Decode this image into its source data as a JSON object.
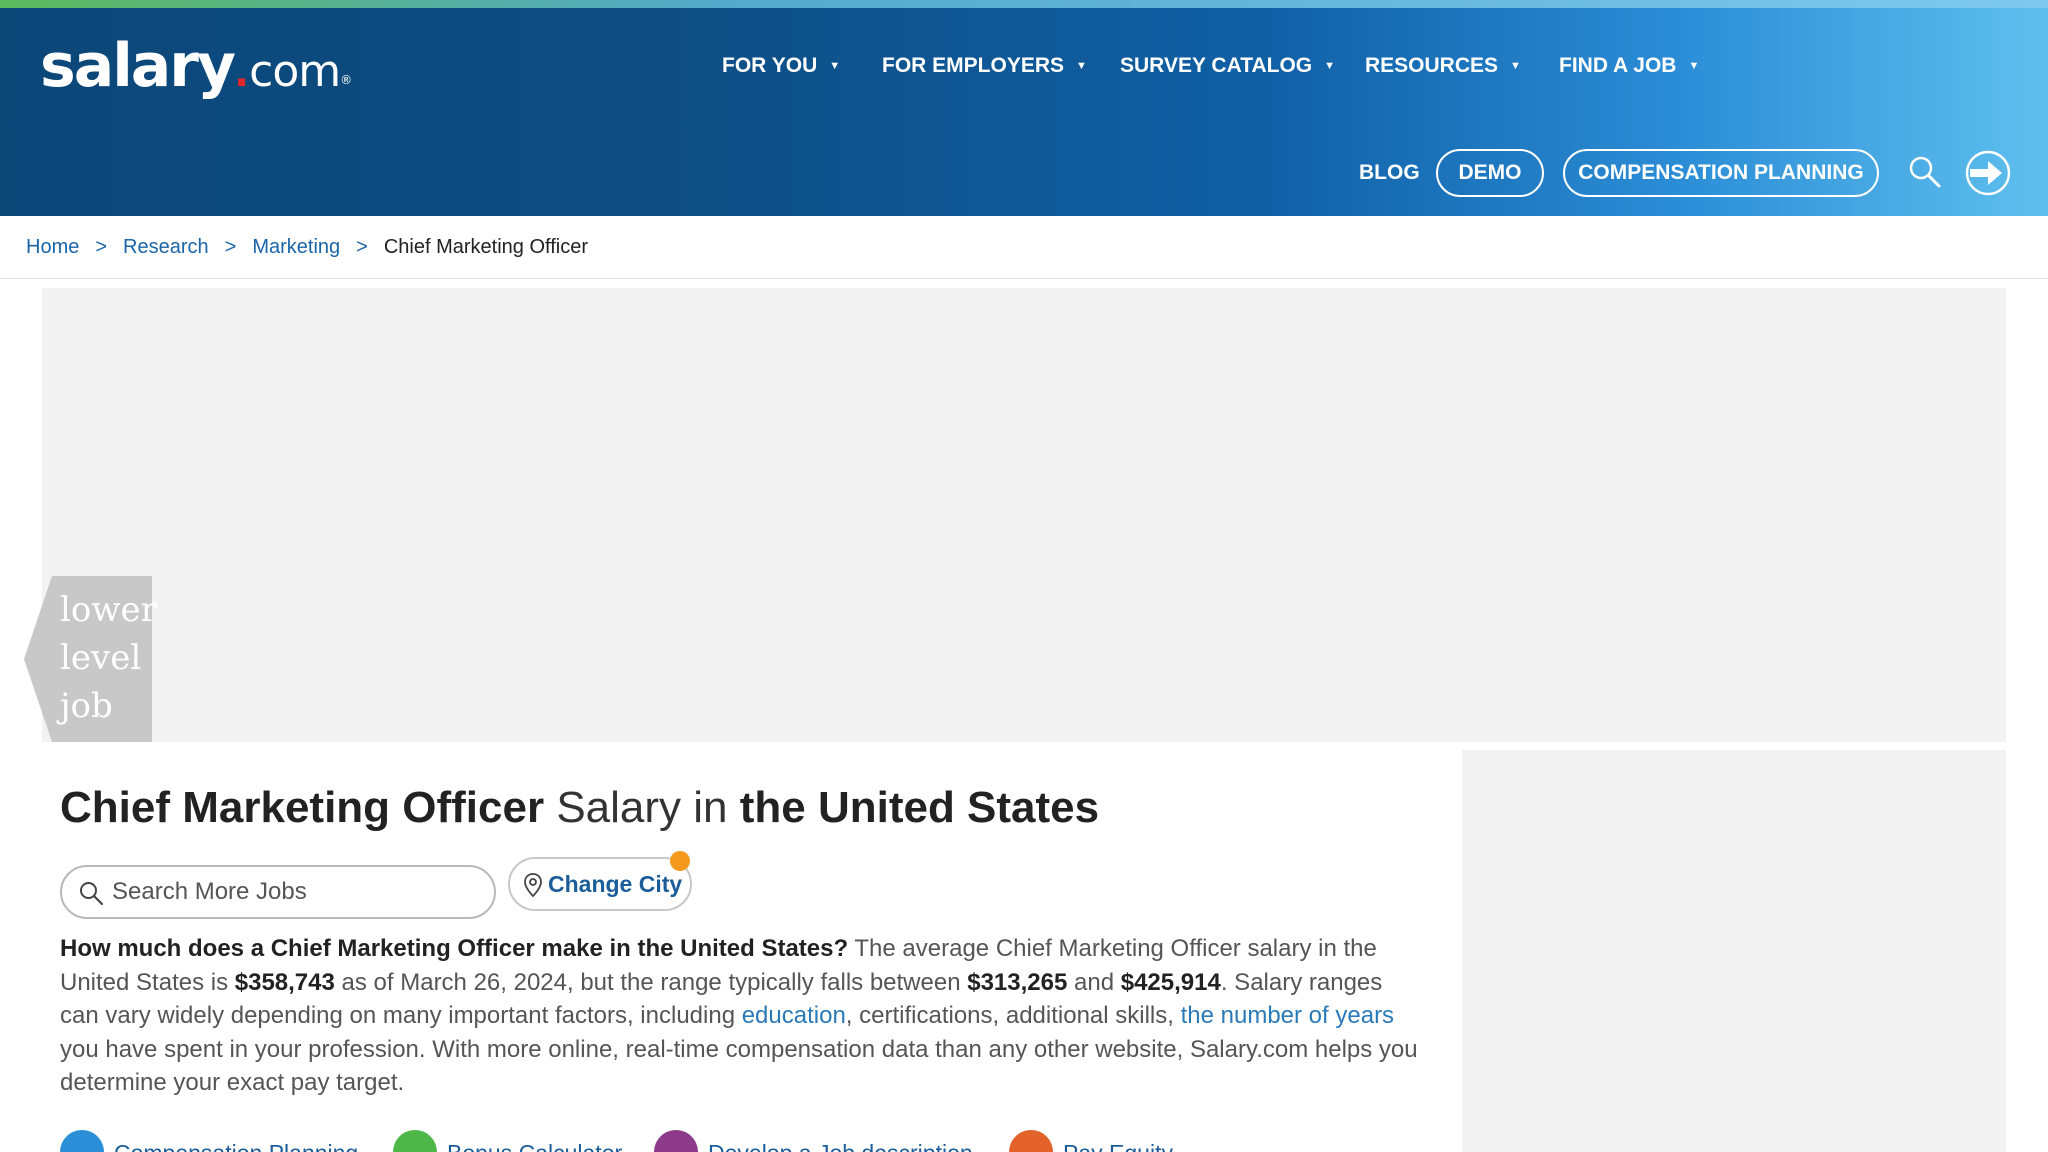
{
  "header": {
    "logo": {
      "main": "salary",
      "dot": ".",
      "tld": "com",
      "reg": "®"
    },
    "nav": [
      {
        "label": "FOR YOU"
      },
      {
        "label": "FOR EMPLOYERS"
      },
      {
        "label": "SURVEY CATALOG"
      },
      {
        "label": "RESOURCES"
      },
      {
        "label": "FIND A JOB"
      }
    ],
    "blog_label": "BLOG",
    "demo_label": "DEMO",
    "comp_label": "COMPENSATION PLANNING"
  },
  "breadcrumb": {
    "home": "Home",
    "research": "Research",
    "marketing": "Marketing",
    "current": "Chief Marketing Officer",
    "sep": ">"
  },
  "banner": {
    "tab_text": "lower level job"
  },
  "main": {
    "title_job": "Chief Marketing Officer",
    "title_mid": " Salary in ",
    "title_location": "the United States",
    "search_placeholder": "Search More Jobs",
    "change_city": "Change City",
    "desc": {
      "question": "How much does a Chief Marketing Officer make in the United States?",
      "p1": " The average Chief Marketing Officer salary in the United States is ",
      "avg": "$358,743",
      "p2": " as of March 26, 2024, but the range typically falls between ",
      "low": "$313,265",
      "p3": " and ",
      "high": "$425,914",
      "p4": ". Salary ranges can vary widely depending on many important factors, including ",
      "link1": "education",
      "p5": ", certifications, additional skills, ",
      "link2": "the number of years",
      "p6": " you have spent in your profession. With more online, real-time compensation data than any other website, Salary.com helps you determine your exact pay target."
    },
    "quicklinks": [
      {
        "label": "Compensation Planning",
        "color": "#2a8fd6"
      },
      {
        "label": "Bonus Calculator",
        "color": "#4db848"
      },
      {
        "label": "Develop a Job description",
        "color": "#8e3a8a"
      },
      {
        "label": "Pay Equity",
        "color": "#e2622a"
      }
    ]
  },
  "colors": {
    "header_dark": "#0b4677",
    "header_light": "#5fc0ee",
    "link": "#1a64a8",
    "accent_orange": "#f39a1e"
  }
}
